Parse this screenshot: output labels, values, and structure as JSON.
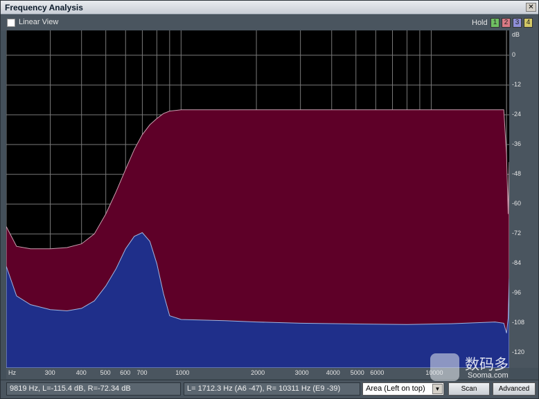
{
  "window": {
    "title": "Frequency Analysis",
    "close_glyph": "✕"
  },
  "toolbar": {
    "linear_view_label": "Linear View",
    "linear_view_checked": false,
    "hold_label": "Hold",
    "hold_buttons": [
      "1",
      "2",
      "3",
      "4"
    ],
    "hold_colors": [
      "#6fbf62",
      "#d87a85",
      "#8f8fd8",
      "#d2c766"
    ]
  },
  "y_axis": {
    "unit": "dB",
    "ticks": [
      "0",
      "-12",
      "-24",
      "-36",
      "-48",
      "-60",
      "-72",
      "-84",
      "-96",
      "-108",
      "-120"
    ]
  },
  "x_axis": {
    "unit": "Hz",
    "ticks": [
      "300",
      "400",
      "500",
      "600",
      "700",
      "1000",
      "2000",
      "3000",
      "4000",
      "5000",
      "6000",
      "10000"
    ]
  },
  "status": {
    "cursor_readout": "9819 Hz, L=-115.4 dB, R=-72.34 dB",
    "peak_readout": "L= 1712.3 Hz (A6 -47), R=  10311 Hz (E9 -39)",
    "view_mode": "Area (Left on top)",
    "scan_label": "Scan",
    "advanced_label": "Advanced"
  },
  "watermark": {
    "text": "数码多",
    "sub": "Sooma.com"
  },
  "chart_data": {
    "type": "area",
    "xlabel": "Hz",
    "ylabel": "dB",
    "xscale": "log",
    "ylim": [
      -126,
      10
    ],
    "grid": true,
    "series": [
      {
        "color": "#5e0028",
        "x": [
          200,
          220,
          250,
          300,
          350,
          400,
          450,
          500,
          550,
          600,
          650,
          700,
          750,
          800,
          850,
          900,
          1000,
          1200,
          1500,
          2000,
          3000,
          5000,
          8000,
          12000,
          18000,
          19500,
          20000,
          20300,
          20500
        ],
        "y": [
          -69,
          -77,
          -78,
          -78,
          -77.5,
          -76,
          -72,
          -64,
          -55,
          -46,
          -38,
          -32,
          -28,
          -25.5,
          -23.5,
          -22.5,
          -22,
          -22,
          -22,
          -22,
          -22,
          -22,
          -22,
          -22,
          -22,
          -22,
          -40,
          -64,
          -43
        ]
      },
      {
        "color": "#1f2f8a",
        "x": [
          200,
          220,
          250,
          300,
          350,
          400,
          450,
          500,
          550,
          600,
          650,
          700,
          750,
          800,
          850,
          900,
          1000,
          1500,
          2000,
          3000,
          5000,
          8000,
          12000,
          18000,
          19500,
          20000,
          20300,
          20500
        ],
        "y": [
          -85,
          -97,
          -100.5,
          -102.5,
          -103,
          -102,
          -99,
          -93,
          -86,
          -78,
          -73,
          -71.5,
          -75,
          -84,
          -96,
          -105,
          -106.5,
          -107,
          -107.5,
          -108,
          -108.3,
          -108.5,
          -108.2,
          -107.5,
          -108,
          -112,
          -106,
          -90
        ]
      }
    ]
  }
}
